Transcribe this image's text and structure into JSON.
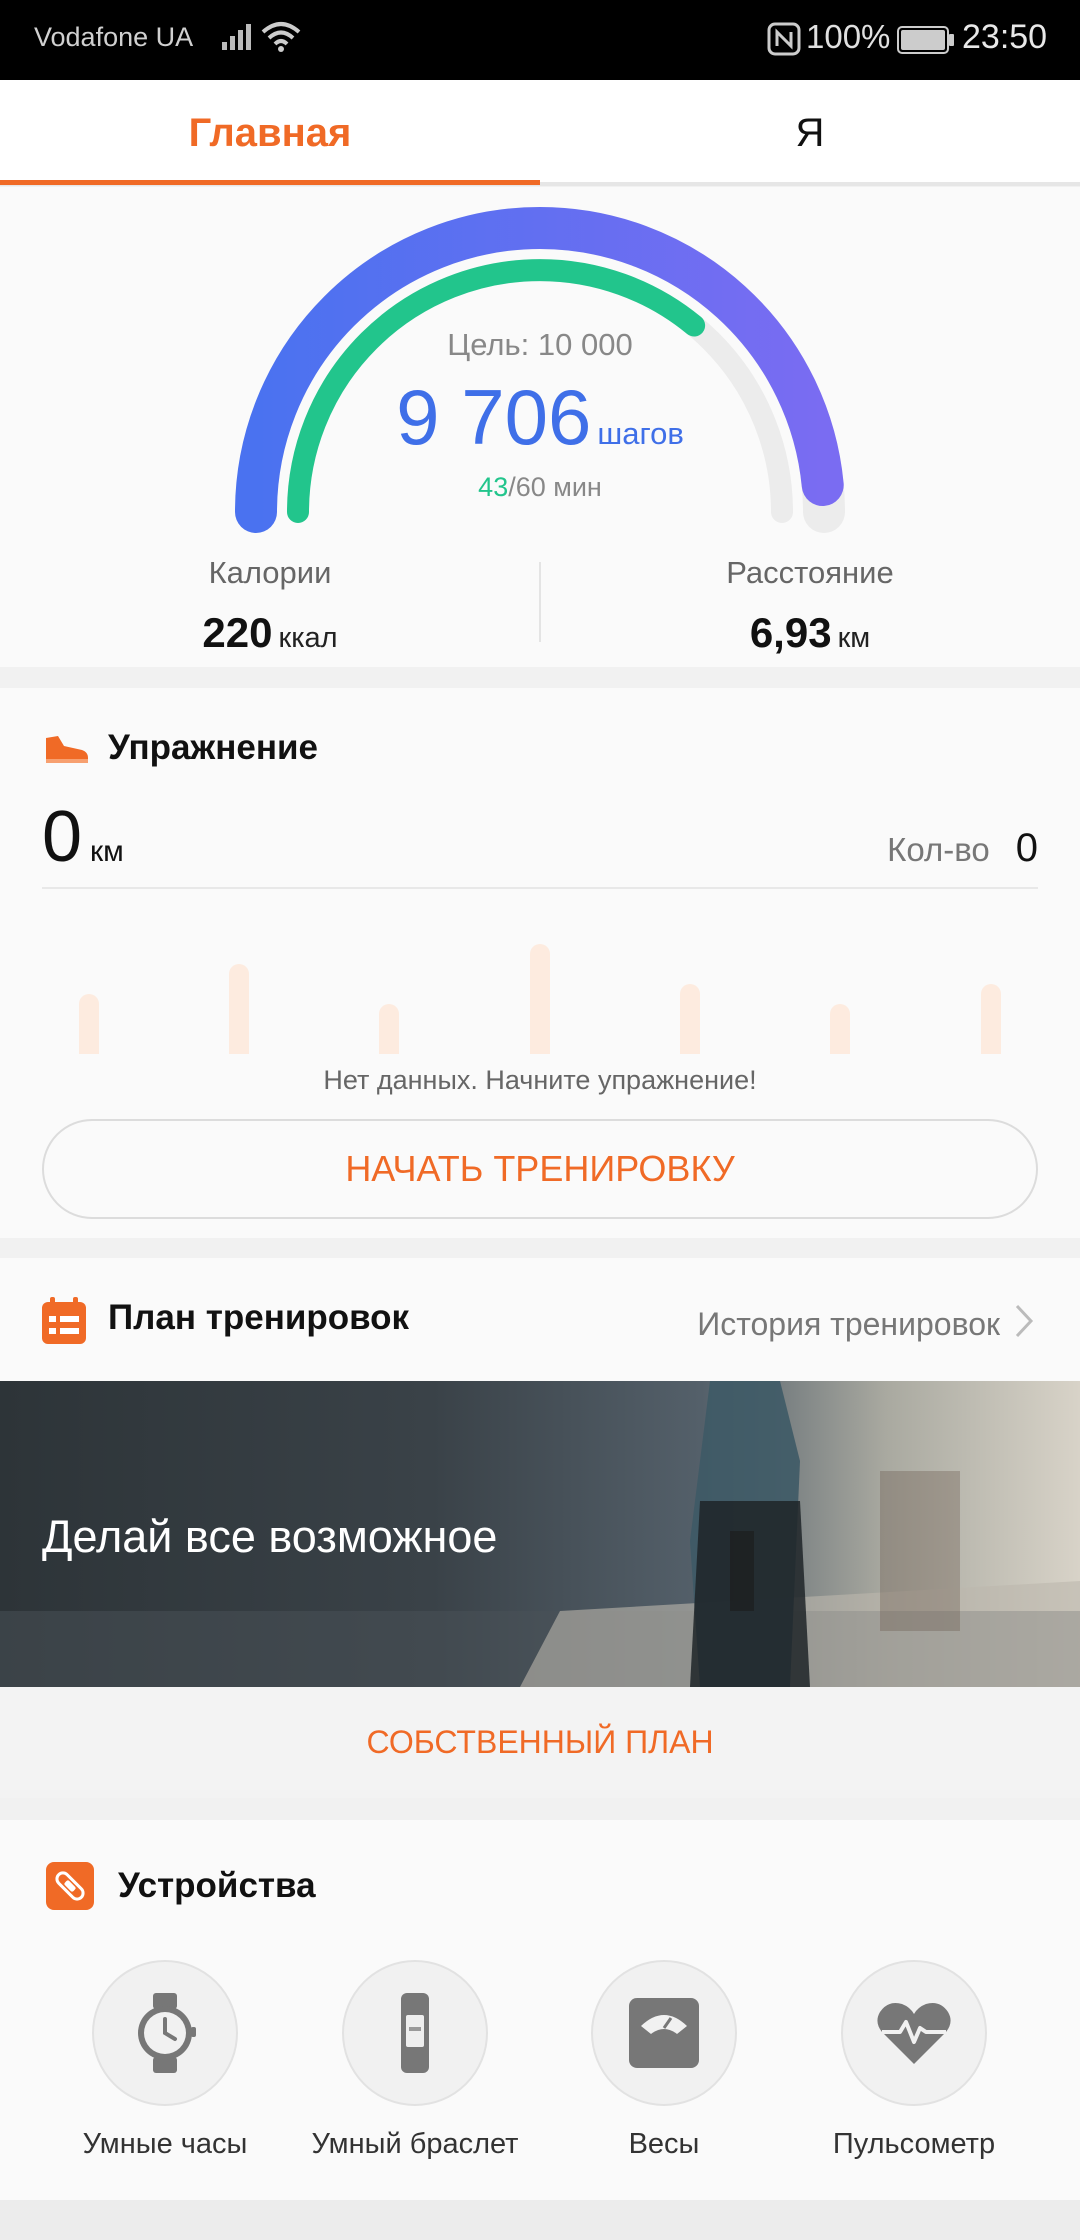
{
  "status_bar": {
    "carrier": "Vodafone UA",
    "battery_percent": "100%",
    "time": "23:50"
  },
  "tabs": [
    {
      "label": "Главная",
      "active": true
    },
    {
      "label": "Я",
      "active": false
    }
  ],
  "steps": {
    "goal_label": "Цель: 10 000",
    "count": "9 706",
    "unit": "шагов",
    "active_minutes": "43",
    "active_minutes_goal": "/60 мин",
    "steps_progress": 0.97,
    "minutes_progress": 0.72
  },
  "stats": {
    "calories_label": "Калории",
    "calories_value": "220",
    "calories_unit": "ккал",
    "distance_label": "Расстояние",
    "distance_value": "6,93",
    "distance_unit": "км"
  },
  "exercise": {
    "title": "Упражнение",
    "distance": "0",
    "distance_unit": "км",
    "count_label": "Кол-во",
    "count_value": "0",
    "no_data": "Нет данных. Начните упражнение!",
    "start_button": "НАЧАТЬ ТРЕНИРОВКУ"
  },
  "plan": {
    "title": "План тренировок",
    "history_link": "История тренировок",
    "banner_text": "Делай все возможное",
    "own_plan_button": "СОБСТВЕННЫЙ ПЛАН"
  },
  "devices": {
    "title": "Устройства",
    "items": [
      {
        "label": "Умные часы",
        "icon": "smartwatch-icon"
      },
      {
        "label": "Умный браслет",
        "icon": "band-icon"
      },
      {
        "label": "Весы",
        "icon": "scale-icon"
      },
      {
        "label": "Пульсометр",
        "icon": "heart-rate-icon"
      }
    ]
  },
  "colors": {
    "accent": "#f06a26",
    "steps_blue": "#3f6fe8",
    "minutes_green": "#22c58c"
  }
}
